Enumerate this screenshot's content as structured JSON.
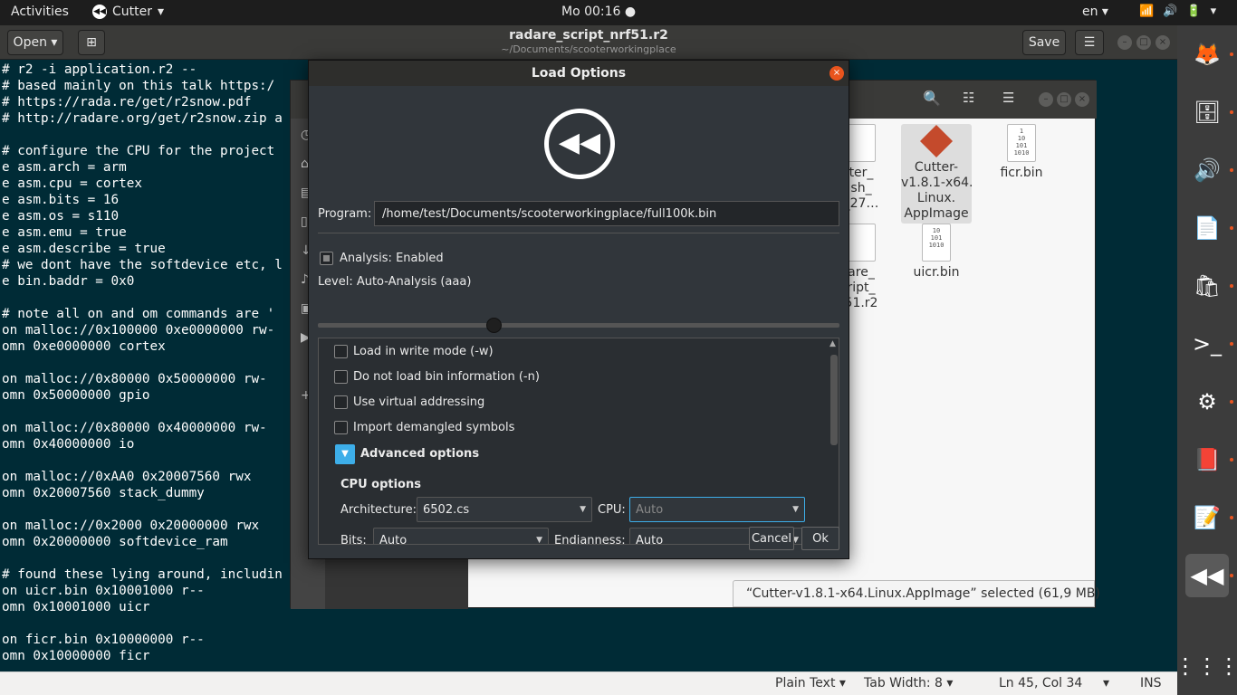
{
  "topbar": {
    "activities": "Activities",
    "app_name": "Cutter",
    "clock": "Mo 00:16 ●",
    "lang": "en ▾",
    "tray": [
      "📶",
      "🔊",
      "🔋",
      "▾"
    ]
  },
  "gedit": {
    "open_label": "Open",
    "title": "radare_script_nrf51.r2",
    "subtitle": "~/Documents/scooterworkingplace",
    "save_label": "Save",
    "lines": [
      "# r2 -i application.r2 --",
      "# based mainly on this talk https:/",
      "# https://rada.re/get/r2snow.pdf",
      "# http://radare.org/get/r2snow.zip a",
      "",
      "# configure the CPU for the project",
      "e asm.arch = arm",
      "e asm.cpu = cortex",
      "e asm.bits = 16",
      "e asm.os = s110",
      "e asm.emu = true",
      "e asm.describe = true",
      "# we dont have the softdevice etc, l",
      "e bin.baddr = 0x0",
      "",
      "# note all on and om commands are '",
      "on malloc://0x100000 0xe0000000 rw-",
      "omn 0xe0000000 cortex",
      "",
      "on malloc://0x80000 0x50000000 rw-",
      "omn 0x50000000 gpio",
      "",
      "on malloc://0x80000 0x40000000 rw-",
      "omn 0x40000000 io",
      "",
      "on malloc://0xAA0 0x20007560 rwx",
      "omn 0x20007560 stack_dummy",
      "",
      "on malloc://0x2000 0x20000000 rwx",
      "omn 0x20000000 softdevice_ram",
      "",
      "# found these lying around, includin",
      "on uicr.bin 0x10001000 r--",
      "omn 0x10001000 uicr",
      "",
      "on ficr.bin 0x10000000 r--",
      "omn 0x10000000 ficr"
    ],
    "status": {
      "plain_text": "Plain Text ▾",
      "tab_width": "Tab Width: 8 ▾",
      "position": "Ln 45, Col 34",
      "dropdown": "▾",
      "ins": "INS"
    }
  },
  "files_window": {
    "items": [
      {
        "name": "ter_\nsh_\n_27…",
        "icon_text": ""
      },
      {
        "name": "Cutter-\nv1.8.1-x64.\nLinux.\nAppImage",
        "icon_text": ""
      },
      {
        "name": "ficr.bin",
        "icon_text": "1\n10\n101\n1010"
      },
      {
        "name": "are_\nript_\n51.r2",
        "icon_text": ""
      },
      {
        "name": "uicr.bin",
        "icon_text": "10\n101\n1010"
      }
    ],
    "selected_status": "“Cutter-v1.8.1-x64.Linux.AppImage” selected  (61,9 MB)"
  },
  "dialog": {
    "title": "Load Options",
    "close_glyph": "×",
    "logo_glyph": "◀◀",
    "program_label": "Program:",
    "program_value": "/home/test/Documents/scooterworkingplace/full100k.bin",
    "analysis_label": "Analysis: Enabled",
    "level_label": "Level: Auto-Analysis (aaa)",
    "level_value_percent": 34,
    "options": [
      {
        "label": "Load in write mode (-w)",
        "checked": false
      },
      {
        "label": "Do not load bin information (-n)",
        "checked": false
      },
      {
        "label": "Use virtual addressing",
        "checked": false
      },
      {
        "label": "Import demangled symbols",
        "checked": false
      }
    ],
    "advanced_label": "Advanced options",
    "cpu_options_label": "CPU options",
    "architecture_label": "Architecture:",
    "architecture_value": "6502.cs",
    "cpu_label": "CPU:",
    "cpu_placeholder": "Auto",
    "bits_label": "Bits:",
    "bits_value": "Auto",
    "endianness_label": "Endianness:",
    "endianness_value": "Auto",
    "cancel_label": "Cancel",
    "ok_label": "Ok"
  },
  "dock": {
    "items": [
      "firefox-icon",
      "files-icon",
      "rhythmbox-icon",
      "writer-icon",
      "software-icon",
      "terminal-icon",
      "settings-icon",
      "document-viewer-icon",
      "text-editor-icon",
      "cutter-icon",
      "app-grid-icon"
    ],
    "glyphs": [
      "🦊",
      "🗄",
      "🔊",
      "📄",
      "🛍",
      ">_",
      "⚙",
      "📕",
      "📝",
      "◀◀",
      "⋮⋮⋮"
    ]
  },
  "colors": {
    "editor_bg": "#002b36",
    "dialog_bg": "#31363b",
    "accent": "#3daee9",
    "close_red": "#e9541d"
  }
}
